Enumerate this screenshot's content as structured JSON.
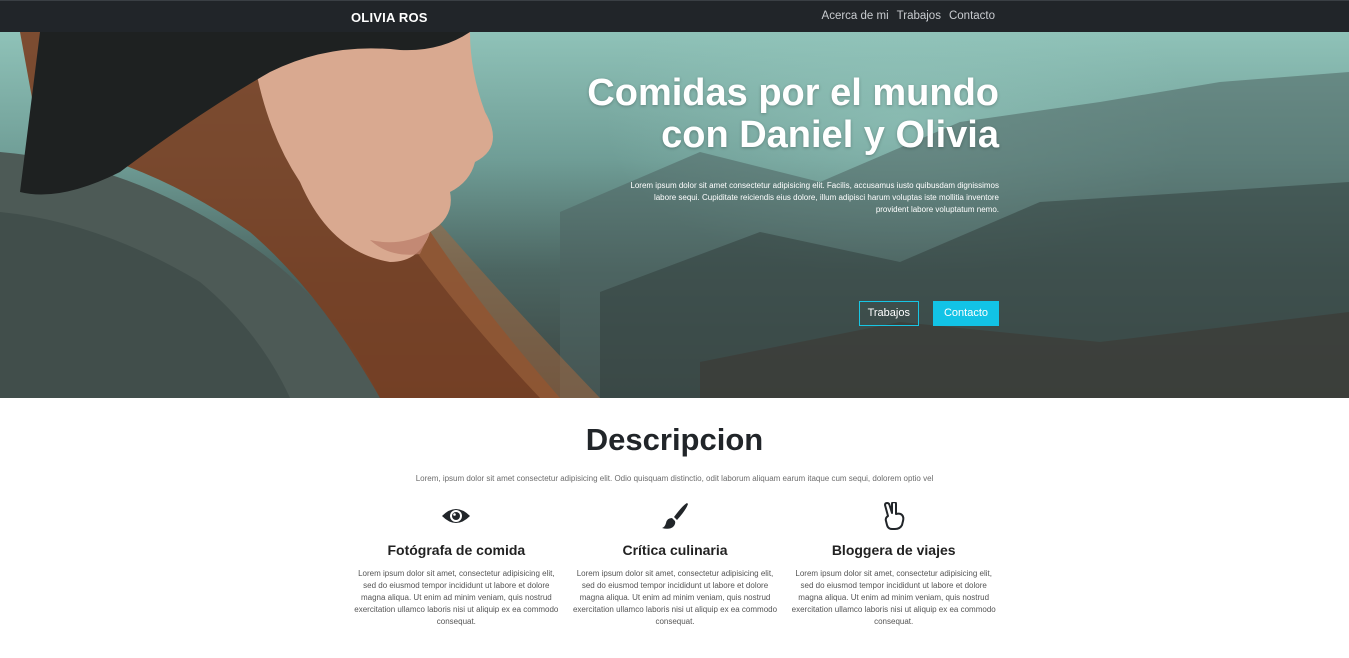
{
  "navbar": {
    "brand": "OLIVIA ROS",
    "links": [
      "Acerca de mi",
      "Trabajos",
      "Contacto"
    ]
  },
  "hero": {
    "title": "Comidas por el mundo con Daniel y Olivia",
    "text": "Lorem ipsum dolor sit amet consectetur adipisicing elit. Facilis, accusamus iusto quibusdam dignissimos labore sequi. Cupiditate reiciendis eius dolore, illum adipisci harum voluptas iste mollitia inventore provident labore voluptatum nemo.",
    "buttons": {
      "trabajos": "Trabajos",
      "contacto": "Contacto"
    }
  },
  "description": {
    "title": "Descripcion",
    "subtitle": "Lorem, ipsum dolor sit amet consectetur adipisicing elit. Odio quisquam distinctio, odit laborum aliquam earum itaque cum sequi, dolorem optio vel"
  },
  "features": [
    {
      "icon": "eye-icon",
      "title": "Fotógrafa de comida",
      "text": "Lorem ipsum dolor sit amet, consectetur adipisicing elit, sed do eiusmod tempor incididunt ut labore et dolore magna aliqua. Ut enim ad minim veniam, quis nostrud exercitation ullamco laboris nisi ut aliquip ex ea commodo consequat."
    },
    {
      "icon": "paint-brush-icon",
      "title": "Crítica culinaria",
      "text": "Lorem ipsum dolor sit amet, consectetur adipisicing elit, sed do eiusmod tempor incididunt ut labore et dolore magna aliqua. Ut enim ad minim veniam, quis nostrud exercitation ullamco laboris nisi ut aliquip ex ea commodo consequat."
    },
    {
      "icon": "peace-hand-icon",
      "title": "Bloggera de viajes",
      "text": "Lorem ipsum dolor sit amet, consectetur adipisicing elit, sed do eiusmod tempor incididunt ut labore et dolore magna aliqua. Ut enim ad minim veniam, quis nostrud exercitation ullamco laboris nisi ut aliquip ex ea commodo consequat."
    }
  ],
  "colors": {
    "navbar": "#212529",
    "accent": "#12c3e6",
    "heading": "#212529"
  }
}
